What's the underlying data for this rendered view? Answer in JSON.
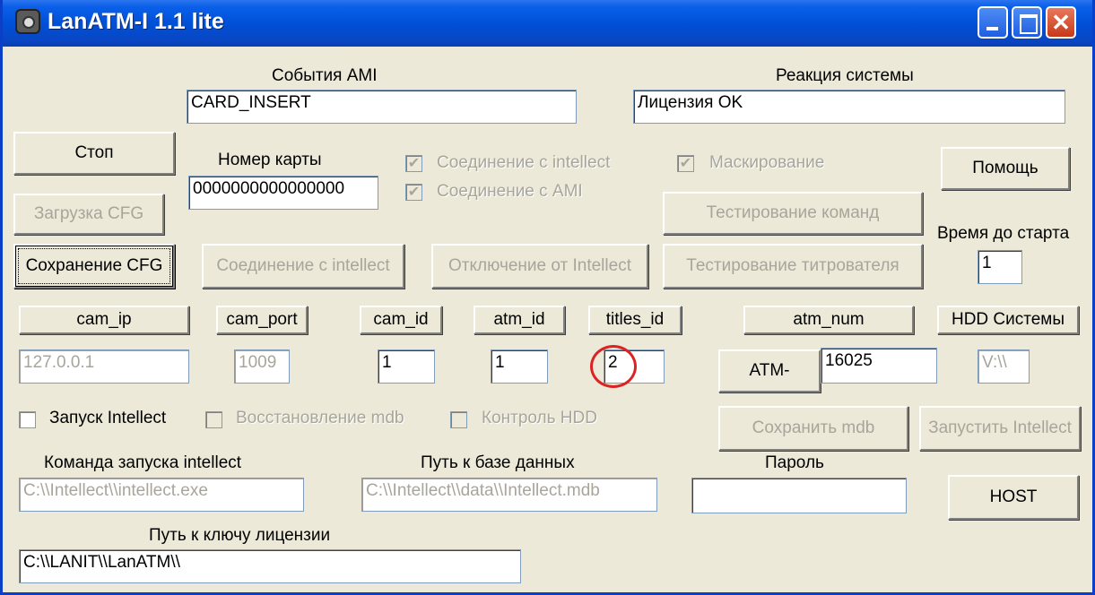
{
  "window": {
    "title": "LanATM-I 1.1 lite",
    "close_glyph": "✕"
  },
  "ami": {
    "label": "События AMI",
    "value": "CARD_INSERT"
  },
  "reaction": {
    "label": "Реакция системы",
    "value": "Лицензия OK"
  },
  "card": {
    "label": "Номер карты",
    "value": "0000000000000000"
  },
  "checks": {
    "conn_intellect": {
      "label": "Соединение с intellect",
      "checked": true,
      "mark": "✔"
    },
    "conn_ami": {
      "label": "Соединение с  AMI",
      "checked": true,
      "mark": "✔"
    },
    "masking": {
      "label": "Маскирование",
      "checked": true,
      "mark": "✔"
    },
    "run_intellect": {
      "label": "Запуск Intellect",
      "checked": false
    },
    "restore_mdb": {
      "label": "Восстановление mdb",
      "checked": false
    },
    "hdd_control": {
      "label": "Контроль HDD",
      "checked": false
    }
  },
  "buttons": {
    "stop": "Стоп",
    "load_cfg": "Загрузка CFG",
    "save_cfg": "Сохранение CFG",
    "connect_intellect": "Соединение с intellect",
    "disconnect_intellect": "Отключение от Intellect",
    "test_titler": "Тестирование титрователя",
    "test_commands": "Тестирование команд",
    "help": "Помощь",
    "save_mdb": "Сохранить mdb",
    "start_intellect": "Запустить Intellect",
    "host": "HOST",
    "atm_prefix": "ATM-"
  },
  "start_time": {
    "label": "Время до старта",
    "value": "1"
  },
  "columns": {
    "cam_ip": {
      "label": "cam_ip",
      "value": "127.0.0.1"
    },
    "cam_port": {
      "label": "cam_port",
      "value": "1009"
    },
    "cam_id": {
      "label": "cam_id",
      "value": "1"
    },
    "atm_id": {
      "label": "atm_id",
      "value": "1"
    },
    "titles_id": {
      "label": "titles_id",
      "value": "2"
    },
    "atm_num": {
      "label": "atm_num",
      "value": "16025"
    },
    "hdd": {
      "label": "HDD Системы",
      "value": "V:\\\\"
    }
  },
  "launch_cmd": {
    "label": "Команда запуска intellect",
    "value": "C:\\\\Intellect\\\\intellect.exe"
  },
  "db_path": {
    "label": "Путь к базе данных",
    "value": "C:\\\\Intellect\\\\data\\\\Intellect.mdb"
  },
  "password": {
    "label": "Пароль",
    "value": ""
  },
  "license": {
    "label": "Путь к ключу лицензии",
    "value": "C:\\\\LANIT\\\\LanATM\\\\"
  }
}
